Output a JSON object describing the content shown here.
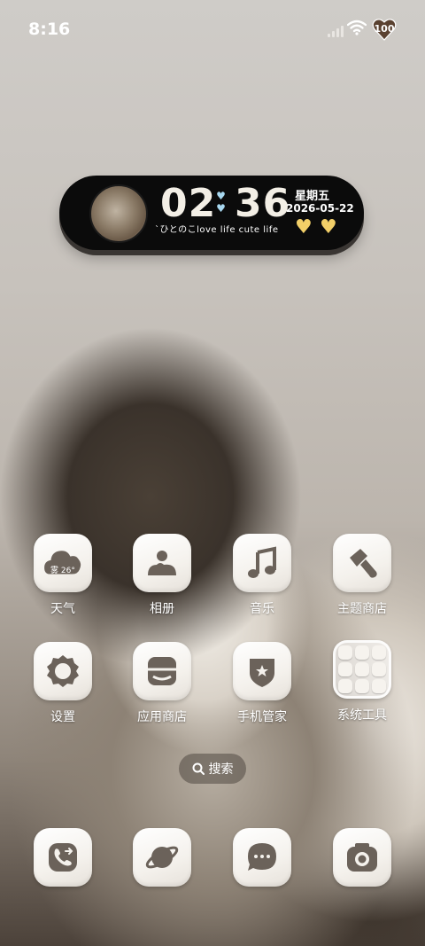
{
  "status_bar": {
    "time": "8:16",
    "battery_level": "100",
    "icons": [
      "signal-icon",
      "wifi-icon",
      "battery-heart-icon"
    ]
  },
  "widget": {
    "hours": "02",
    "minutes": "36",
    "weekday": "星期五",
    "date": "2026-05-22",
    "tagline": "`ひとのこlove life cute life",
    "decorations": [
      "yellow-heart-icon",
      "yellow-heart-icon"
    ]
  },
  "apps": [
    {
      "label": "天气",
      "icon": "weather-cloud-icon",
      "weather_text": "雾 26°"
    },
    {
      "label": "相册",
      "icon": "photo-icon"
    },
    {
      "label": "音乐",
      "icon": "music-note-icon"
    },
    {
      "label": "主题商店",
      "icon": "paintbrush-icon"
    },
    {
      "label": "设置",
      "icon": "gear-icon"
    },
    {
      "label": "应用商店",
      "icon": "store-box-icon"
    },
    {
      "label": "手机管家",
      "icon": "shield-star-icon"
    },
    {
      "label": "系统工具",
      "icon": "folder-icon"
    }
  ],
  "search": {
    "label": "搜索",
    "icon": "search-icon"
  },
  "dock": [
    {
      "name": "phone",
      "icon": "phone-icon"
    },
    {
      "name": "browser",
      "icon": "planet-icon"
    },
    {
      "name": "messages",
      "icon": "chat-bubble-icon"
    },
    {
      "name": "camera",
      "icon": "camera-icon"
    }
  ],
  "colors": {
    "icon_glyph": "#6b625a",
    "tile_bg": "#f4f1ec",
    "widget_bg": "#0b0b0b",
    "heart_yellow": "#f2cf68",
    "heart_blue": "#a8d8f0"
  }
}
